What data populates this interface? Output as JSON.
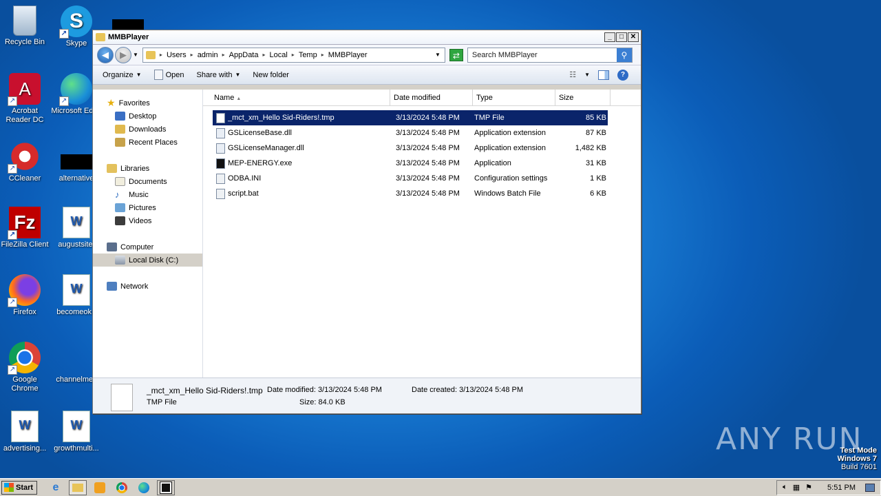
{
  "desktop": {
    "icons": [
      {
        "label": "Recycle Bin"
      },
      {
        "label": "Skype"
      },
      {
        "label": "Acrobat\nReader DC"
      },
      {
        "label": "Microsoft Edge"
      },
      {
        "label": "CCleaner"
      },
      {
        "label": "alternative"
      },
      {
        "label": "FileZilla Client"
      },
      {
        "label": "augustsite."
      },
      {
        "label": "Firefox"
      },
      {
        "label": "becomeok.r"
      },
      {
        "label": "Google\nChrome"
      },
      {
        "label": "channelmex"
      },
      {
        "label": "advertising..."
      },
      {
        "label": "growthmulti..."
      }
    ]
  },
  "window": {
    "title": "MMBPlayer",
    "controls": {
      "minimize": "_",
      "maximize": "□",
      "close": "✕"
    },
    "address": [
      "Users",
      "admin",
      "AppData",
      "Local",
      "Temp",
      "MMBPlayer"
    ],
    "search_placeholder": "Search MMBPlayer",
    "toolbar": {
      "organize": "Organize",
      "open": "Open",
      "share": "Share with",
      "new_folder": "New folder"
    },
    "nav": {
      "favorites": "Favorites",
      "desktop": "Desktop",
      "downloads": "Downloads",
      "recent": "Recent Places",
      "libraries": "Libraries",
      "documents": "Documents",
      "music": "Music",
      "pictures": "Pictures",
      "videos": "Videos",
      "computer": "Computer",
      "local_disk": "Local Disk (C:)",
      "network": "Network"
    },
    "columns": {
      "name": "Name",
      "date": "Date modified",
      "type": "Type",
      "size": "Size"
    },
    "files": [
      {
        "name": "_mct_xm_Hello Sid-Riders!.tmp",
        "date": "3/13/2024 5:48 PM",
        "type": "TMP File",
        "size": "85 KB"
      },
      {
        "name": "GSLicenseBase.dll",
        "date": "3/13/2024 5:48 PM",
        "type": "Application extension",
        "size": "87 KB"
      },
      {
        "name": "GSLicenseManager.dll",
        "date": "3/13/2024 5:48 PM",
        "type": "Application extension",
        "size": "1,482 KB"
      },
      {
        "name": "MEP-ENERGY.exe",
        "date": "3/13/2024 5:48 PM",
        "type": "Application",
        "size": "31 KB"
      },
      {
        "name": "ODBA.INI",
        "date": "3/13/2024 5:48 PM",
        "type": "Configuration settings",
        "size": "1 KB"
      },
      {
        "name": "script.bat",
        "date": "3/13/2024 5:48 PM",
        "type": "Windows Batch File",
        "size": "6 KB"
      }
    ],
    "details": {
      "name": "_mct_xm_Hello Sid-Riders!.tmp",
      "type": "TMP File",
      "modified": "Date modified: 3/13/2024 5:48 PM",
      "size": "Size: 84.0 KB",
      "created": "Date created: 3/13/2024 5:48 PM"
    }
  },
  "taskbar": {
    "start": "Start",
    "time": "5:51 PM"
  },
  "watermark": {
    "line1": "Test Mode",
    "line2": "Windows 7",
    "line3": "Build 7601",
    "brand": "ANY RUN"
  },
  "colors": {
    "selection": "#0a246a",
    "desktop": "#1a7fd6"
  }
}
